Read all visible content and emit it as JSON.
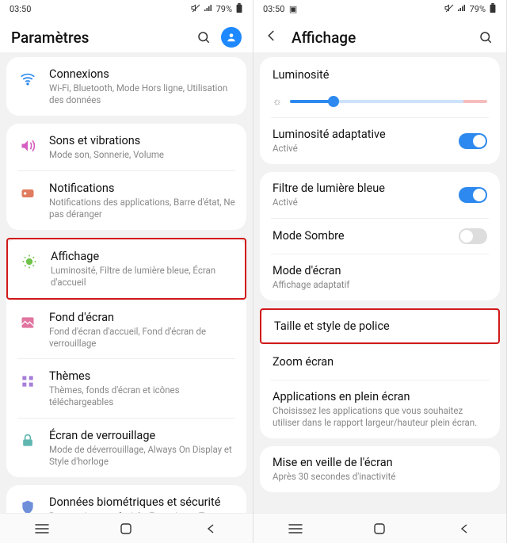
{
  "status": {
    "time": "03:50",
    "battery": "79%"
  },
  "left": {
    "header_title": "Paramètres",
    "sections": [
      {
        "rows": [
          {
            "icon": "wifi-icon",
            "icon_color": "#2d89ef",
            "title": "Connexions",
            "sub": "Wi-Fi, Bluetooth, Mode Hors ligne, Utilisation des données"
          }
        ]
      },
      {
        "rows": [
          {
            "icon": "sound-icon",
            "icon_color": "#d55fc1",
            "title": "Sons et vibrations",
            "sub": "Mode son, Sonnerie, Volume"
          },
          {
            "icon": "notifications-icon",
            "icon_color": "#e07b5f",
            "title": "Notifications",
            "sub": "Notifications des applications, Barre d'état, Ne pas déranger"
          }
        ]
      },
      {
        "rows": [
          {
            "icon": "display-icon",
            "icon_color": "#6fc24a",
            "title": "Affichage",
            "sub": "Luminosité, Filtre de lumière bleue, Écran d'accueil",
            "highlight": true
          },
          {
            "icon": "wallpaper-icon",
            "icon_color": "#e0759f",
            "title": "Fond d'écran",
            "sub": "Fond d'écran d'accueil, Fond d'écran de verrouillage"
          },
          {
            "icon": "themes-icon",
            "icon_color": "#a77fd9",
            "title": "Thèmes",
            "sub": "Thèmes, fonds d'écran et icônes téléchargeables"
          },
          {
            "icon": "lockscreen-icon",
            "icon_color": "#5fb6b0",
            "title": "Écran de verrouillage",
            "sub": "Mode de déverrouillage, Always On Display et Style d'horloge"
          }
        ]
      },
      {
        "rows": [
          {
            "icon": "biometrics-icon",
            "icon_color": "#6f8fd9",
            "title": "Données biométriques et sécurité",
            "sub": "Reconnaissance faciale, Empreintes, Traçage du mobile"
          }
        ]
      }
    ]
  },
  "right": {
    "header_title": "Affichage",
    "brightness_label": "Luminosité",
    "adaptive": {
      "title": "Luminosité adaptative",
      "sub": "Activé",
      "on": true
    },
    "blue_filter": {
      "title": "Filtre de lumière bleue",
      "sub": "Activé",
      "on": true
    },
    "dark_mode": {
      "title": "Mode Sombre",
      "on": false
    },
    "screen_mode": {
      "title": "Mode d'écran",
      "sub": "Affichage adaptatif"
    },
    "font": {
      "title": "Taille et style de police",
      "highlight": true
    },
    "zoom": {
      "title": "Zoom écran"
    },
    "fullscreen": {
      "title": "Applications en plein écran",
      "sub": "Choisissez les applications que vous souhaitez utiliser dans le rapport largeur/hauteur plein écran."
    },
    "sleep": {
      "title": "Mise en veille de l'écran",
      "sub": "Après 30 secondes d'inactivité"
    }
  }
}
